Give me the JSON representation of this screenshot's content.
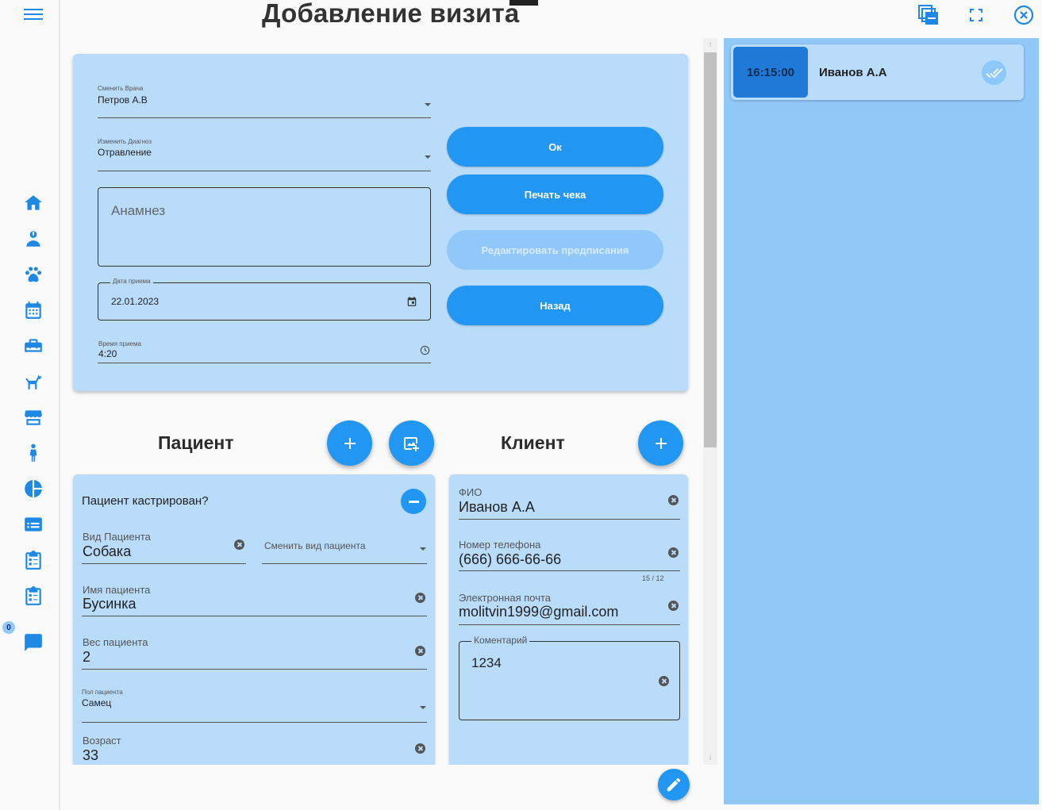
{
  "page": {
    "title": "Добавление визита"
  },
  "sidebar": {
    "badge_count": "0"
  },
  "visit_form": {
    "doctor": {
      "label": "Сменить Врача",
      "value": "Петров А.В"
    },
    "diagnosis": {
      "label": "Изменить Диагноз",
      "value": "Отравление"
    },
    "anamnesis": {
      "placeholder": "Анамнез"
    },
    "date": {
      "label": "Дата приема",
      "value": "22.01.2023"
    },
    "time": {
      "label": "Время приема",
      "value": "4:20"
    }
  },
  "actions": {
    "ok": "Ок",
    "print": "Печать чека",
    "edit_prescriptions": "Редактировать предписания",
    "back": "Назад"
  },
  "patient": {
    "heading": "Пациент",
    "neutered_question": "Пациент кастрирован?",
    "species": {
      "label": "Вид Пациента",
      "value": "Собака"
    },
    "change_species": {
      "label": "Сменить вид пациента"
    },
    "name": {
      "label": "Имя пациента",
      "value": "Бусинка"
    },
    "weight": {
      "label": "Вес пациента",
      "value": "2"
    },
    "sex": {
      "label": "Пол пациента",
      "value": "Самец"
    },
    "age": {
      "label": "Возраст",
      "value": "33"
    }
  },
  "client": {
    "heading": "Клиент",
    "fio": {
      "label": "ФИО",
      "value": "Иванов А.А"
    },
    "phone": {
      "label": "Номер телефона",
      "value": "(666) 666-66-66",
      "counter": "15 / 12"
    },
    "email": {
      "label": "Электронная почта",
      "value": "molitvin1999@gmail.com"
    },
    "comment": {
      "label": "Коментарий",
      "value": "1234"
    }
  },
  "schedule": [
    {
      "time": "16:15:00",
      "name": "Иванов А.А"
    }
  ],
  "colors": {
    "accent": "#2196f3",
    "card": "#b9dcfb",
    "panel": "#90c8f8"
  }
}
